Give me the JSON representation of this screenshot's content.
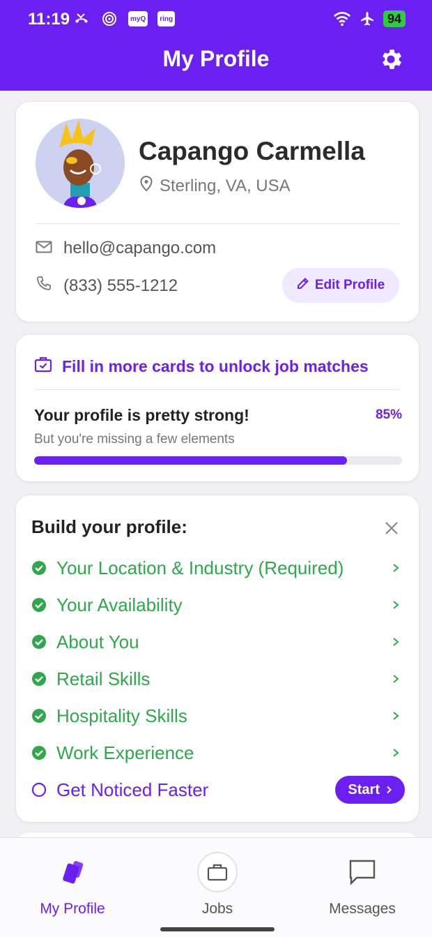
{
  "status_bar": {
    "time": "11:19",
    "badge_myq": "myQ",
    "badge_ring": "ring",
    "battery": "94"
  },
  "header": {
    "title": "My Profile",
    "settings_icon": "gear-icon"
  },
  "profile": {
    "name": "Capango Carmella",
    "location": "Sterling, VA, USA",
    "email": "hello@capango.com",
    "phone": "(833) 555-1212",
    "edit_label": "Edit Profile"
  },
  "progress": {
    "unlock_text": "Fill in more cards to unlock job matches",
    "strength_text": "Your profile is pretty strong!",
    "percent_label": "85%",
    "percent_value": 0.85,
    "missing_text": "But you're missing a few elements"
  },
  "build": {
    "title": "Build your profile:",
    "items": [
      {
        "label": "Your Location & Industry (Required)",
        "done": true
      },
      {
        "label": "Your Availability",
        "done": true
      },
      {
        "label": "About You",
        "done": true
      },
      {
        "label": "Retail Skills",
        "done": true
      },
      {
        "label": "Hospitality Skills",
        "done": true
      },
      {
        "label": "Work Experience",
        "done": true
      },
      {
        "label": "Get Noticed Faster",
        "done": false
      }
    ],
    "start_label": "Start"
  },
  "nav": {
    "items": [
      {
        "label": "My Profile",
        "active": true
      },
      {
        "label": "Jobs",
        "active": false
      },
      {
        "label": "Messages",
        "active": false
      }
    ]
  },
  "colors": {
    "brand": "#6b1ff0",
    "success": "#2da84a"
  }
}
